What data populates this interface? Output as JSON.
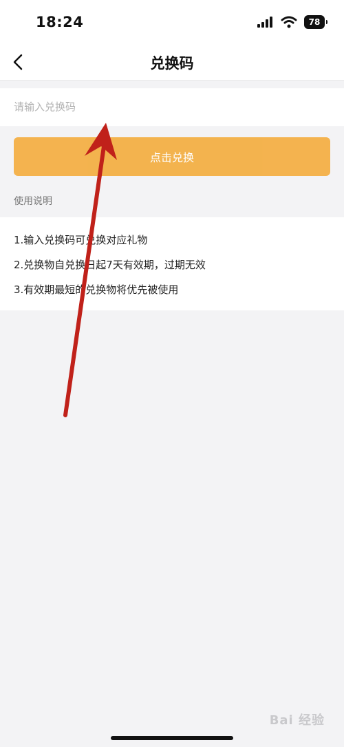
{
  "status_bar": {
    "time": "18:24",
    "battery": "78",
    "icons": [
      "signal-icon",
      "wifi-icon",
      "battery-icon"
    ]
  },
  "nav": {
    "title": "兑换码",
    "back_icon": "chevron-left-icon"
  },
  "form": {
    "placeholder": "请输入兑换码",
    "value": "",
    "redeem_label": "点击兑换",
    "button_color": "#f4ae40"
  },
  "instructions": {
    "heading": "使用说明",
    "items": [
      "1.输入兑换码可兑换对应礼物",
      "2.兑换物自兑换日起7天有效期，过期无效",
      "3.有效期最短的兑换物将优先被使用"
    ]
  },
  "annotation": {
    "arrow_icon": "red-arrow-icon",
    "color": "#c0211a"
  },
  "watermark": {
    "text": "Bai 经验"
  }
}
